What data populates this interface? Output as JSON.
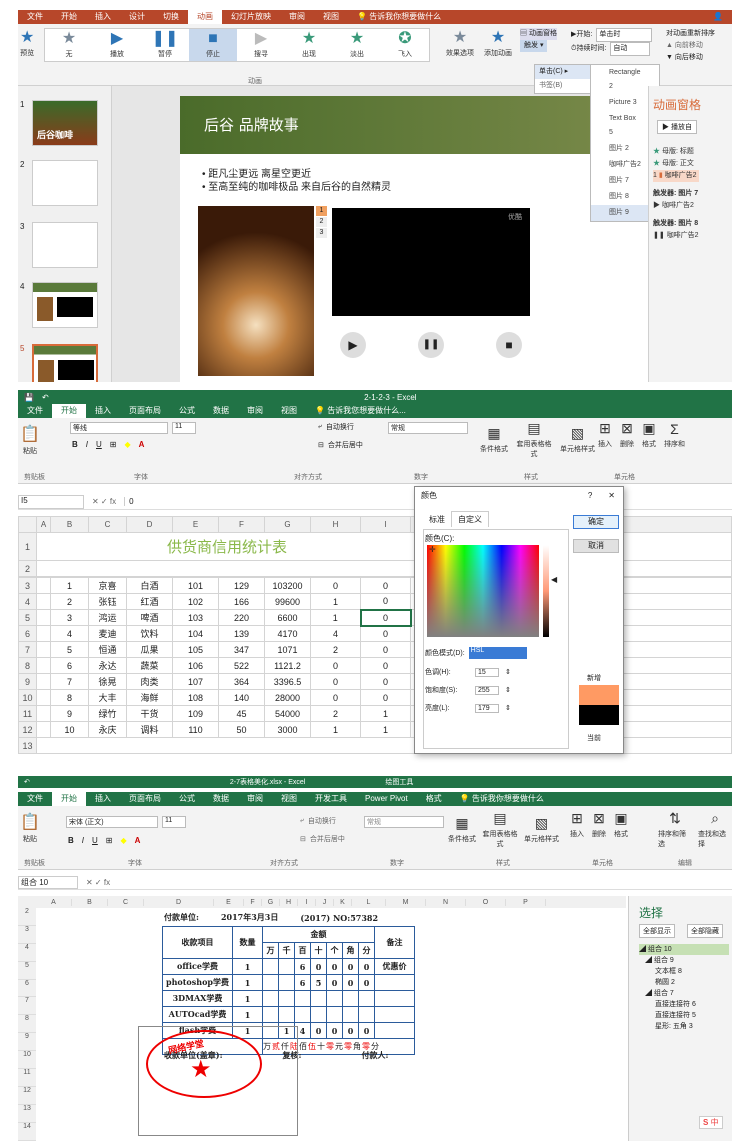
{
  "ppt": {
    "tabs": [
      "文件",
      "开始",
      "插入",
      "设计",
      "切换",
      "动画",
      "幻灯片放映",
      "审阅",
      "视图"
    ],
    "active_tab": "动画",
    "search_hint": "告诉我你想要做什么",
    "preview_label": "预览",
    "effects": [
      "无",
      "播放",
      "暂停",
      "停止",
      "搜寻",
      "出现",
      "淡出",
      "飞入"
    ],
    "effect_options": "效果选项",
    "add_animation": "添加动画",
    "animation_pane_btn": "动画窗格",
    "trigger": "触发",
    "start_label": "开始:",
    "start_value": "单击时",
    "duration_label": "持续时间:",
    "duration_value": "自动",
    "reorder": "对动画重新排序",
    "move_earlier": "向前移动",
    "move_later": "向后移动",
    "group_label": "动画",
    "trigger_menu": [
      "单击(C)",
      "书签(B)"
    ],
    "shapes_menu": [
      "Rectangle 2",
      "Picture 3",
      "Text Box 5",
      "图片 2",
      "咖啡广告2",
      "图片 7",
      "图片 8",
      "图片 9"
    ],
    "slide_numbers": [
      "1",
      "2",
      "3",
      "4",
      "5"
    ],
    "thumb1_text": "后谷咖啡",
    "slide_title": "后谷  品牌故事",
    "bullets": [
      "距凡尘更远    离星空更近",
      "至高至纯的咖啡极品    来自后谷的自然精灵"
    ],
    "video_label": "优酷",
    "tag_numbers": [
      "1",
      "2",
      "3"
    ],
    "pane_title": "动画窗格",
    "play_from": "播放自",
    "pane_items": [
      "母版: 标题",
      "母版: 正文",
      "咖啡广告2"
    ],
    "pane_item_num": "1",
    "trigger7": "触发器: 图片 7",
    "trigger7_item": "咖啡广告2",
    "trigger8": "触发器: 图片 8",
    "trigger8_item": "咖啡广告2"
  },
  "excel1": {
    "title_bar": "2-1-2-3 - Excel",
    "tabs": [
      "文件",
      "开始",
      "插入",
      "页面布局",
      "公式",
      "数据",
      "审阅",
      "视图"
    ],
    "active_tab": "开始",
    "search_hint": "告诉我您想要做什么...",
    "font_name": "等线",
    "font_size": "11",
    "number_format": "常规",
    "wrap_text": "自动换行",
    "merge_center": "合并后居中",
    "groups": [
      "剪贴板",
      "字体",
      "对齐方式",
      "数字",
      "样式",
      "单元格"
    ],
    "paste": "粘贴",
    "styles": [
      "条件格式",
      "套用表格格式",
      "单元格样式"
    ],
    "cells": [
      "插入",
      "删除",
      "格式"
    ],
    "sort": "排序和",
    "name_box": "I5",
    "formula": "0",
    "columns": [
      "A",
      "B",
      "C",
      "D",
      "E",
      "F",
      "G",
      "H",
      "I",
      "J",
      "K",
      "L",
      "M",
      "N",
      "O",
      "P"
    ],
    "sheet_title": "供货商信用统计表",
    "rows": [
      [
        "1",
        "京喜",
        "白酒",
        "101",
        "129",
        "103200",
        "0",
        "0"
      ],
      [
        "2",
        "张钰",
        "红酒",
        "102",
        "166",
        "99600",
        "1",
        "0"
      ],
      [
        "3",
        "鸿运",
        "啤酒",
        "103",
        "220",
        "6600",
        "1",
        "0"
      ],
      [
        "4",
        "麦迪",
        "饮料",
        "104",
        "139",
        "4170",
        "4",
        "0"
      ],
      [
        "5",
        "恒通",
        "瓜果",
        "105",
        "347",
        "1071",
        "2",
        "0"
      ],
      [
        "6",
        "永达",
        "蔬菜",
        "106",
        "522",
        "1121.2",
        "0",
        "0"
      ],
      [
        "7",
        "徐晃",
        "肉类",
        "107",
        "364",
        "3396.5",
        "0",
        "0"
      ],
      [
        "8",
        "大丰",
        "海鲜",
        "108",
        "140",
        "28000",
        "0",
        "0"
      ],
      [
        "9",
        "绿竹",
        "干货",
        "109",
        "45",
        "54000",
        "2",
        "1"
      ],
      [
        "10",
        "永庆",
        "调料",
        "110",
        "50",
        "3000",
        "1",
        "1"
      ]
    ],
    "row_numbers": [
      "1",
      "2",
      "3",
      "4",
      "5",
      "6",
      "7",
      "8",
      "9",
      "10",
      "11",
      "12",
      "13"
    ],
    "dialog": {
      "title": "颜色",
      "help": "?",
      "tabs": [
        "标准",
        "自定义"
      ],
      "active_tab": "自定义",
      "colors_label": "颜色(C):",
      "model_label": "颜色模式(D):",
      "model_value": "HSL",
      "hue_label": "色调(H):",
      "hue_value": "15",
      "sat_label": "饱和度(S):",
      "sat_value": "255",
      "lum_label": "亮度(L):",
      "lum_value": "179",
      "ok": "确定",
      "cancel": "取消",
      "new_label": "新增",
      "current_label": "当前",
      "new_color": "#ff9a63",
      "current_color": "#000000"
    }
  },
  "excel2": {
    "title_bar": "2-7表格美化.xlsx - Excel",
    "tool_title": "绘图工具",
    "tabs": [
      "文件",
      "开始",
      "插入",
      "页面布局",
      "公式",
      "数据",
      "审阅",
      "视图",
      "开发工具",
      "Power Pivot",
      "格式"
    ],
    "active_tab": "开始",
    "search_hint": "告诉我你想要做什么",
    "font_name": "宋体 (正文)",
    "font_size": "11",
    "number_format": "常规",
    "wrap_text": "自动换行",
    "merge_center": "合并后居中",
    "groups": [
      "剪贴板",
      "字体",
      "对齐方式",
      "数字",
      "样式",
      "单元格",
      "编辑"
    ],
    "paste": "粘贴",
    "styles": [
      "条件格式",
      "套用表格格式",
      "单元格样式"
    ],
    "cells": [
      "插入",
      "删除",
      "格式"
    ],
    "editing": [
      "排序和筛选",
      "查找和选择"
    ],
    "name_box": "组合 10",
    "columns": [
      "A",
      "B",
      "C",
      "D",
      "E",
      "F",
      "G",
      "H",
      "I",
      "J",
      "K",
      "L",
      "M",
      "N",
      "O",
      "P"
    ],
    "row_numbers": [
      "2",
      "3",
      "4",
      "5",
      "6",
      "7",
      "8",
      "9",
      "10",
      "11",
      "12",
      "13",
      "14"
    ],
    "payee_label": "付款单位:",
    "date": "2017年3月3日",
    "number": "(2017) NO:57382",
    "headers": [
      "收款项目",
      "数量",
      "金额",
      "备注"
    ],
    "units": [
      "万",
      "千",
      "百",
      "十",
      "个",
      "角",
      "分"
    ],
    "items": [
      {
        "name": "office学费",
        "qty": "1",
        "amt": [
          "",
          "",
          "6",
          "0",
          "0",
          "0",
          "0"
        ],
        "note": "优惠价"
      },
      {
        "name": "photoshop学费",
        "qty": "1",
        "amt": [
          "",
          "",
          "6",
          "5",
          "0",
          "0",
          "0"
        ],
        "note": ""
      },
      {
        "name": "3DMAX学费",
        "qty": "1",
        "amt": [
          "",
          "",
          "",
          "",
          "",
          "",
          ""
        ],
        "note": ""
      },
      {
        "name": "AUTOcad学费",
        "qty": "1",
        "amt": [
          "",
          "",
          "",
          "",
          "",
          "",
          ""
        ],
        "note": ""
      },
      {
        "name": "flash学费",
        "qty": "1",
        "amt": [
          "",
          "1",
          "4",
          "0",
          "0",
          "0",
          "0"
        ],
        "note": ""
      }
    ],
    "capital": [
      "万",
      "贰",
      "仟",
      "陆",
      "佰",
      "伍",
      "十",
      "零",
      "元",
      "零",
      "角",
      "零",
      "分"
    ],
    "receiver": "收款单位(盖章):",
    "checker": "复核:",
    "payer": "付款人:",
    "stamp_text": "网络学堂",
    "selection_title": "选择",
    "show_all": "全部显示",
    "hide_all": "全部隐藏",
    "tree": [
      "组合 10",
      "组合 9",
      "文本框 8",
      "椭圆 2",
      "组合 7",
      "直接连接符 6",
      "直接连接符 5",
      "星形: 五角 3"
    ],
    "ime": "中"
  }
}
